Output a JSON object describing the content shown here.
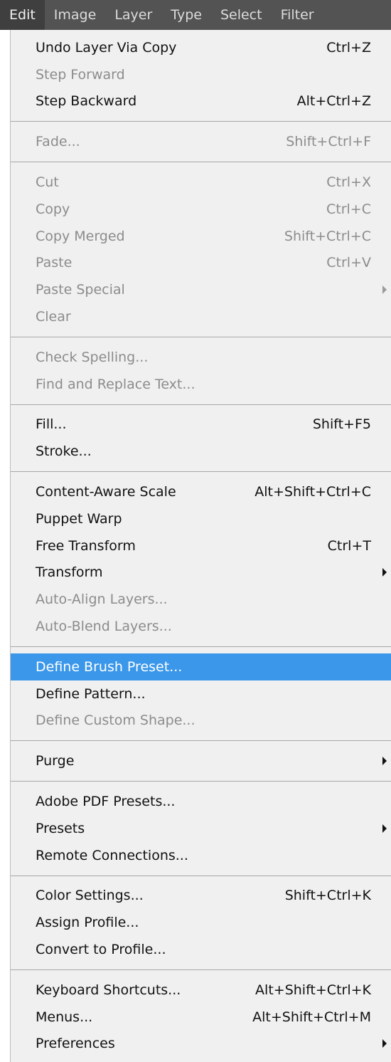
{
  "menubar": {
    "items": [
      {
        "label": "Edit",
        "active": true
      },
      {
        "label": "Image"
      },
      {
        "label": "Layer"
      },
      {
        "label": "Type"
      },
      {
        "label": "Select"
      },
      {
        "label": "Filter"
      }
    ]
  },
  "menu": {
    "groups": [
      [
        {
          "label": "Undo Layer Via Copy",
          "shortcut": "Ctrl+Z",
          "enabled": true
        },
        {
          "label": "Step Forward",
          "shortcut": "",
          "enabled": false
        },
        {
          "label": "Step Backward",
          "shortcut": "Alt+Ctrl+Z",
          "enabled": true
        }
      ],
      [
        {
          "label": "Fade...",
          "shortcut": "Shift+Ctrl+F",
          "enabled": false
        }
      ],
      [
        {
          "label": "Cut",
          "shortcut": "Ctrl+X",
          "enabled": false
        },
        {
          "label": "Copy",
          "shortcut": "Ctrl+C",
          "enabled": false
        },
        {
          "label": "Copy Merged",
          "shortcut": "Shift+Ctrl+C",
          "enabled": false
        },
        {
          "label": "Paste",
          "shortcut": "Ctrl+V",
          "enabled": false
        },
        {
          "label": "Paste Special",
          "shortcut": "",
          "enabled": false,
          "submenu": true
        },
        {
          "label": "Clear",
          "shortcut": "",
          "enabled": false
        }
      ],
      [
        {
          "label": "Check Spelling...",
          "shortcut": "",
          "enabled": false
        },
        {
          "label": "Find and Replace Text...",
          "shortcut": "",
          "enabled": false
        }
      ],
      [
        {
          "label": "Fill...",
          "shortcut": "Shift+F5",
          "enabled": true
        },
        {
          "label": "Stroke...",
          "shortcut": "",
          "enabled": true
        }
      ],
      [
        {
          "label": "Content-Aware Scale",
          "shortcut": "Alt+Shift+Ctrl+C",
          "enabled": true
        },
        {
          "label": "Puppet Warp",
          "shortcut": "",
          "enabled": true
        },
        {
          "label": "Free Transform",
          "shortcut": "Ctrl+T",
          "enabled": true
        },
        {
          "label": "Transform",
          "shortcut": "",
          "enabled": true,
          "submenu": true
        },
        {
          "label": "Auto-Align Layers...",
          "shortcut": "",
          "enabled": false
        },
        {
          "label": "Auto-Blend Layers...",
          "shortcut": "",
          "enabled": false
        }
      ],
      [
        {
          "label": "Define Brush Preset...",
          "shortcut": "",
          "enabled": true,
          "highlighted": true
        },
        {
          "label": "Define Pattern...",
          "shortcut": "",
          "enabled": true
        },
        {
          "label": "Define Custom Shape...",
          "shortcut": "",
          "enabled": false
        }
      ],
      [
        {
          "label": "Purge",
          "shortcut": "",
          "enabled": true,
          "submenu": true
        }
      ],
      [
        {
          "label": "Adobe PDF Presets...",
          "shortcut": "",
          "enabled": true
        },
        {
          "label": "Presets",
          "shortcut": "",
          "enabled": true,
          "submenu": true
        },
        {
          "label": "Remote Connections...",
          "shortcut": "",
          "enabled": true
        }
      ],
      [
        {
          "label": "Color Settings...",
          "shortcut": "Shift+Ctrl+K",
          "enabled": true
        },
        {
          "label": "Assign Profile...",
          "shortcut": "",
          "enabled": true
        },
        {
          "label": "Convert to Profile...",
          "shortcut": "",
          "enabled": true
        }
      ],
      [
        {
          "label": "Keyboard Shortcuts...",
          "shortcut": "Alt+Shift+Ctrl+K",
          "enabled": true
        },
        {
          "label": "Menus...",
          "shortcut": "Alt+Shift+Ctrl+M",
          "enabled": true
        },
        {
          "label": "Preferences",
          "shortcut": "",
          "enabled": true,
          "submenu": true
        }
      ]
    ]
  },
  "colors": {
    "menubar_bg": "#535353",
    "menubar_active_bg": "#3f3f3f",
    "menu_bg": "#f0f0f0",
    "highlight": "#3a97e9",
    "disabled_text": "#8c8c8c"
  }
}
